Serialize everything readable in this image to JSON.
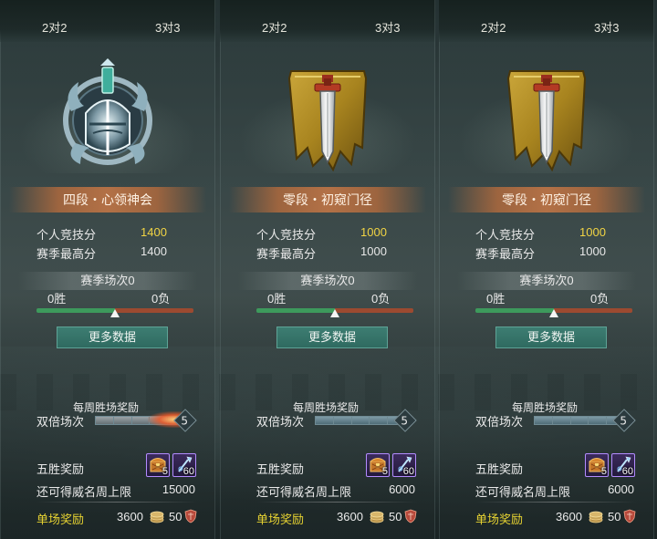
{
  "colors": {
    "score_highlight": "#f1d444",
    "single_reward": "#e7d332",
    "button_bg": "#2f6a60",
    "win_bar": "#3d9a5c",
    "loss_bar": "#9c4a30",
    "item_border": "#b38cff"
  },
  "panels": [
    {
      "tabs": [
        "2对2",
        "3对3"
      ],
      "emblem": "silver-helmet-emblem",
      "rank": "四段・心领神会",
      "personal_score_label": "个人竞技分",
      "personal_score": "1400",
      "season_best_label": "赛季最高分",
      "season_best": "1400",
      "season_matches": "赛季场次0",
      "wins": "0胜",
      "losses": "0负",
      "win_ratio": 0.5,
      "more_button": "更多数据",
      "weekly_title": "每周胜场奖励",
      "double_label": "双倍场次",
      "double_count": "5",
      "double_highlight": true,
      "five_win_label": "五胜奖励",
      "rewards": [
        {
          "icon": "treasure-chest-icon",
          "count": "5"
        },
        {
          "icon": "spear-icon",
          "count": "60"
        }
      ],
      "cap_label": "还可得威名周上限",
      "cap_value": "15000",
      "single_label": "单场奖励",
      "single_coin": "3600",
      "single_honor": "50"
    },
    {
      "tabs": [
        "2对2",
        "3对3"
      ],
      "emblem": "gold-banner-sword-emblem",
      "rank": "零段・初窥门径",
      "personal_score_label": "个人竞技分",
      "personal_score": "1000",
      "season_best_label": "赛季最高分",
      "season_best": "1000",
      "season_matches": "赛季场次0",
      "wins": "0胜",
      "losses": "0负",
      "win_ratio": 0.5,
      "more_button": "更多数据",
      "weekly_title": "每周胜场奖励",
      "double_label": "双倍场次",
      "double_count": "5",
      "double_highlight": false,
      "five_win_label": "五胜奖励",
      "rewards": [
        {
          "icon": "treasure-chest-icon",
          "count": "5"
        },
        {
          "icon": "spear-icon",
          "count": "60"
        }
      ],
      "cap_label": "还可得威名周上限",
      "cap_value": "6000",
      "single_label": "单场奖励",
      "single_coin": "3600",
      "single_honor": "50"
    },
    {
      "tabs": [
        "2对2",
        "3对3"
      ],
      "emblem": "gold-banner-sword-emblem",
      "rank": "零段・初窥门径",
      "personal_score_label": "个人竞技分",
      "personal_score": "1000",
      "season_best_label": "赛季最高分",
      "season_best": "1000",
      "season_matches": "赛季场次0",
      "wins": "0胜",
      "losses": "0负",
      "win_ratio": 0.5,
      "more_button": "更多数据",
      "weekly_title": "每周胜场奖励",
      "double_label": "双倍场次",
      "double_count": "5",
      "double_highlight": false,
      "five_win_label": "五胜奖励",
      "rewards": [
        {
          "icon": "treasure-chest-icon",
          "count": "5"
        },
        {
          "icon": "spear-icon",
          "count": "60"
        }
      ],
      "cap_label": "还可得威名周上限",
      "cap_value": "6000",
      "single_label": "单场奖励",
      "single_coin": "3600",
      "single_honor": "50"
    }
  ]
}
